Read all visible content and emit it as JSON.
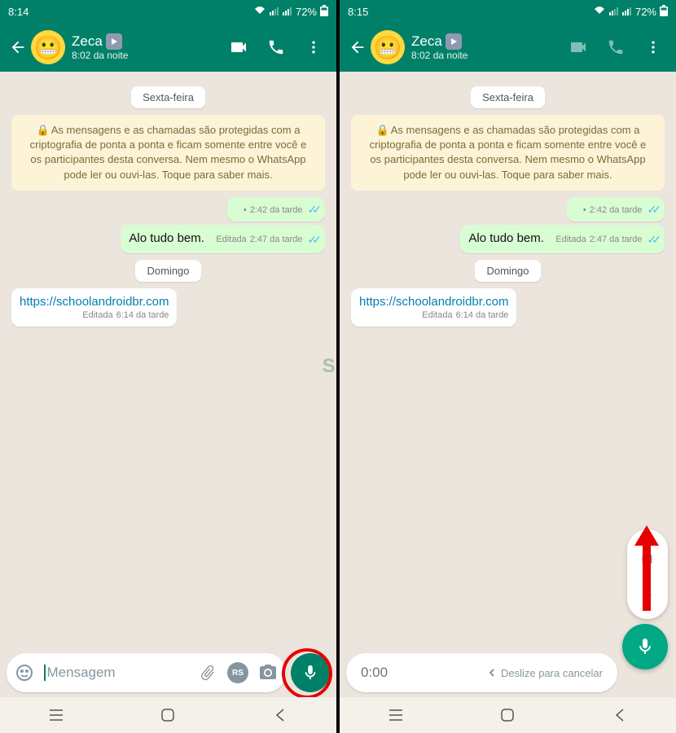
{
  "left": {
    "status": {
      "time": "8:14",
      "battery": "72%"
    },
    "header": {
      "name": "Zeca",
      "last_seen": "8:02 da noite"
    },
    "chat": {
      "day1": "Sexta-feira",
      "encryption": "As mensagens e as chamadas são protegidas com a criptografia de ponta a ponta e ficam somente entre você e os participantes desta conversa. Nem mesmo o WhatsApp pode ler ou ouvi-las. Toque para saber mais.",
      "msg1": {
        "time": "2:42 da tarde"
      },
      "msg2": {
        "text": "Alo tudo bem.",
        "edited": "Editada",
        "time": "2:47 da tarde"
      },
      "day2": "Domingo",
      "msg3": {
        "link": "https://schoolandroidbr.com",
        "edited": "Editada",
        "time": "6:14 da tarde"
      }
    },
    "input": {
      "placeholder": "Mensagem"
    }
  },
  "right": {
    "status": {
      "time": "8:15",
      "battery": "72%"
    },
    "header": {
      "name": "Zeca",
      "last_seen": "8:02 da noite"
    },
    "chat": {
      "day1": "Sexta-feira",
      "encryption": "As mensagens e as chamadas são protegidas com a criptografia de ponta a ponta e ficam somente entre você e os participantes desta conversa. Nem mesmo o WhatsApp pode ler ou ouvi-las. Toque para saber mais.",
      "msg1": {
        "time": "2:42 da tarde"
      },
      "msg2": {
        "text": "Alo tudo bem.",
        "edited": "Editada",
        "time": "2:47 da tarde"
      },
      "day2": "Domingo",
      "msg3": {
        "link": "https://schoolandroidbr.com",
        "edited": "Editada",
        "time": "6:14 da tarde"
      }
    },
    "recording": {
      "timer": "0:00",
      "cancel": "Deslize para cancelar"
    }
  },
  "watermark": "SA",
  "rs_label": "RS"
}
